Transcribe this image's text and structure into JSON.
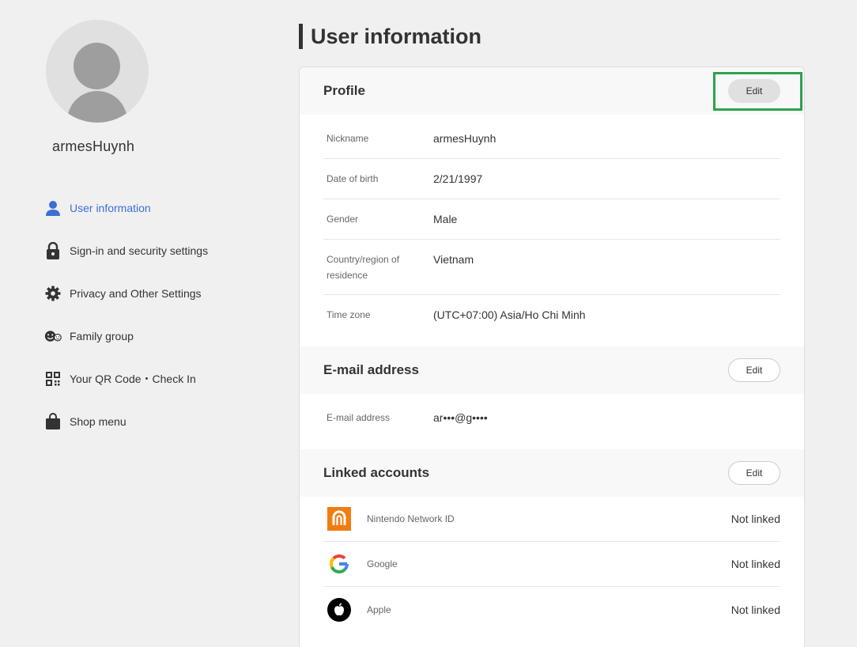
{
  "sidebar": {
    "username": "armesHuynh",
    "items": [
      {
        "label": "User information",
        "icon": "person-icon"
      },
      {
        "label": "Sign-in and security settings",
        "icon": "lock-icon"
      },
      {
        "label": "Privacy and Other Settings",
        "icon": "gear-icon"
      },
      {
        "label": "Family group",
        "icon": "family-icon"
      },
      {
        "label": "Your QR Code・Check In",
        "icon": "qr-code-icon"
      },
      {
        "label": "Shop menu",
        "icon": "shopping-bag-icon"
      }
    ]
  },
  "main": {
    "title": "User information",
    "profile": {
      "heading": "Profile",
      "edit_label": "Edit",
      "fields": [
        {
          "label": "Nickname",
          "value": "armesHuynh"
        },
        {
          "label": "Date of birth",
          "value": "2/21/1997"
        },
        {
          "label": "Gender",
          "value": "Male"
        },
        {
          "label": "Country/region of residence",
          "value": "Vietnam"
        },
        {
          "label": "Time zone",
          "value": "(UTC+07:00) Asia/Ho Chi Minh"
        }
      ]
    },
    "email": {
      "heading": "E-mail address",
      "edit_label": "Edit",
      "label": "E-mail address",
      "value": "ar•••@g••••"
    },
    "linked": {
      "heading": "Linked accounts",
      "edit_label": "Edit",
      "accounts": [
        {
          "name": "Nintendo Network ID",
          "status": "Not linked"
        },
        {
          "name": "Google",
          "status": "Not linked"
        },
        {
          "name": "Apple",
          "status": "Not linked"
        }
      ]
    }
  },
  "colors": {
    "accent": "#3b6fd6",
    "highlight": "#2ea24a",
    "nintendo_orange": "#f07d12"
  }
}
